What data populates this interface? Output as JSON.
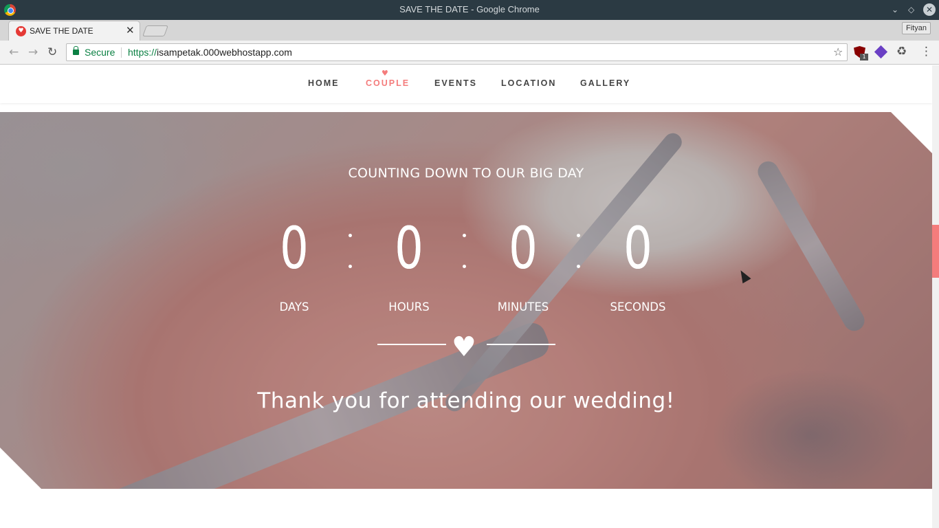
{
  "window": {
    "title": "SAVE THE DATE - Google Chrome"
  },
  "tab": {
    "title": "SAVE THE DATE",
    "close": "✕"
  },
  "profile": {
    "name": "Fityan"
  },
  "toolbar": {
    "back": "←",
    "forward": "→",
    "reload": "↻",
    "security_label": "Secure",
    "url_scheme": "https://",
    "url_host": "isampetak.000webhostapp.com",
    "star": "☆",
    "ublock_badge": "1",
    "menu": "⋮"
  },
  "nav": {
    "items": [
      {
        "label": "HOME",
        "active": false
      },
      {
        "label": "COUPLE",
        "active": true
      },
      {
        "label": "EVENTS",
        "active": false
      },
      {
        "label": "LOCATION",
        "active": false
      },
      {
        "label": "GALLERY",
        "active": false
      }
    ],
    "active_marker": "♥"
  },
  "countdown": {
    "heading": "COUNTING DOWN TO OUR BIG DAY",
    "units": [
      {
        "value": "0",
        "label": "DAYS"
      },
      {
        "value": "0",
        "label": "HOURS"
      },
      {
        "value": "0",
        "label": "MINUTES"
      },
      {
        "value": "0",
        "label": "SECONDS"
      }
    ]
  },
  "divider_icon": "♥",
  "message": "Thank you for attending our wedding!",
  "colors": {
    "accent": "#f47c7c",
    "titlebar": "#2b3a43",
    "secure_green": "#0b8043"
  }
}
